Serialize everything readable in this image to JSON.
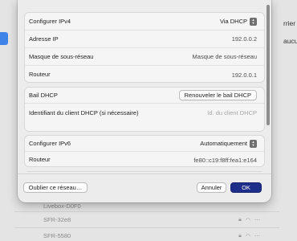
{
  "background": {
    "right_texts": [
      "rrier",
      "aucu"
    ],
    "networks": [
      "Livebox-D0F0",
      "SFR-32e8",
      "SFR-5580"
    ]
  },
  "ipv4": {
    "configure_label": "Configurer IPv4",
    "configure_value": "Via DHCP",
    "ip_label": "Adresse IP",
    "ip_value": "192.0.0.2",
    "mask_label": "Masque de sous-réseau",
    "mask_value": "Masque de sous-réseau",
    "router_label": "Routeur",
    "router_value": "192.0.0.1"
  },
  "dhcp": {
    "lease_label": "Bail DHCP",
    "renew_button": "Renouveler le bail DHCP",
    "client_id_label": "Identifiant du client DHCP (si nécessaire)",
    "client_id_placeholder": "Id. du client DHCP"
  },
  "ipv6": {
    "configure_label": "Configurer IPv6",
    "configure_value": "Automatiquement",
    "router_label": "Routeur",
    "router_value": "fe80::c19:f8ff:fea1:e164"
  },
  "footer": {
    "forget_button": "Oublier ce réseau…",
    "cancel_button": "Annuler",
    "ok_button": "OK"
  },
  "colors": {
    "accent": "#1d2e8a",
    "selection_blue": "#3f83e8"
  },
  "icons": [
    "chevron-updown-icon",
    "lock-icon",
    "wifi-icon",
    "more-icon"
  ]
}
